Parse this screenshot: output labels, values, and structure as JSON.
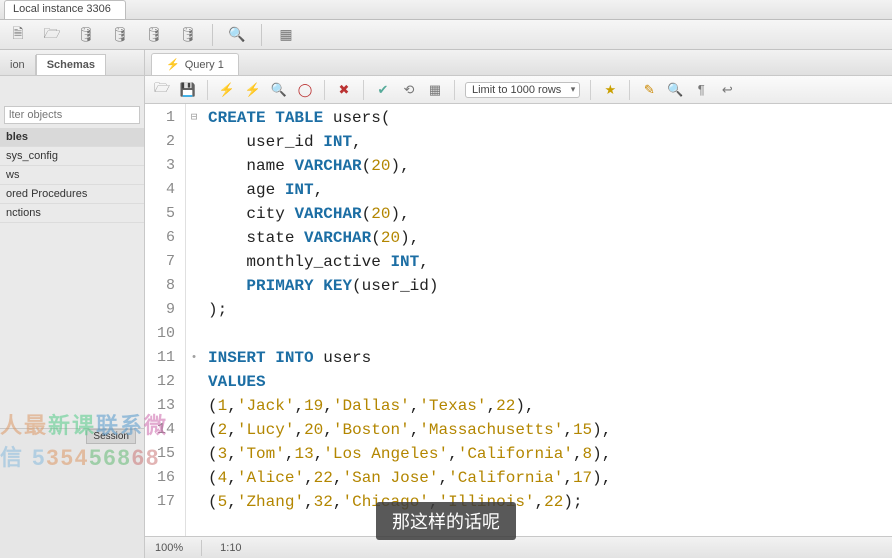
{
  "window": {
    "connection_tab": "Local instance 3306"
  },
  "left": {
    "tabs": {
      "first": "ion",
      "second": "Schemas"
    },
    "filter_placeholder": "lter objects",
    "items": [
      "bles",
      "sys_config",
      "ws",
      "ored Procedures",
      "nctions"
    ],
    "session_label": "Session"
  },
  "query": {
    "tab_label": "Query 1",
    "limit_label": "Limit to 1000 rows"
  },
  "status": {
    "zoom": "100%",
    "pos": "1:10"
  },
  "subtitle": "那这样的话呢",
  "watermark": {
    "line1": "人最新课联系微",
    "line2": "信 535456868"
  },
  "sql_lines": [
    {
      "n": 1,
      "fold": "⊟",
      "tokens": [
        [
          "kw",
          "CREATE TABLE"
        ],
        [
          "id",
          " users"
        ],
        [
          "pn",
          "("
        ]
      ]
    },
    {
      "n": 2,
      "tokens": [
        [
          "id",
          "    user_id "
        ],
        [
          "ty",
          "INT"
        ],
        [
          "pn",
          ","
        ]
      ]
    },
    {
      "n": 3,
      "tokens": [
        [
          "id",
          "    name "
        ],
        [
          "ty",
          "VARCHAR"
        ],
        [
          "pn",
          "("
        ],
        [
          "num",
          "20"
        ],
        [
          "pn",
          "),"
        ]
      ]
    },
    {
      "n": 4,
      "tokens": [
        [
          "id",
          "    age "
        ],
        [
          "ty",
          "INT"
        ],
        [
          "pn",
          ","
        ]
      ]
    },
    {
      "n": 5,
      "tokens": [
        [
          "id",
          "    city "
        ],
        [
          "ty",
          "VARCHAR"
        ],
        [
          "pn",
          "("
        ],
        [
          "num",
          "20"
        ],
        [
          "pn",
          "),"
        ]
      ]
    },
    {
      "n": 6,
      "tokens": [
        [
          "id",
          "    state "
        ],
        [
          "ty",
          "VARCHAR"
        ],
        [
          "pn",
          "("
        ],
        [
          "num",
          "20"
        ],
        [
          "pn",
          "),"
        ]
      ]
    },
    {
      "n": 7,
      "tokens": [
        [
          "id",
          "    monthly_active "
        ],
        [
          "ty",
          "INT"
        ],
        [
          "pn",
          ","
        ]
      ]
    },
    {
      "n": 8,
      "tokens": [
        [
          "id",
          "    "
        ],
        [
          "fn",
          "PRIMARY KEY"
        ],
        [
          "pn",
          "("
        ],
        [
          "id",
          "user_id"
        ],
        [
          "pn",
          ")"
        ]
      ]
    },
    {
      "n": 9,
      "tokens": [
        [
          "pn",
          ");"
        ]
      ]
    },
    {
      "n": 10,
      "tokens": []
    },
    {
      "n": 11,
      "fold": "•",
      "tokens": [
        [
          "kw",
          "INSERT INTO"
        ],
        [
          "id",
          " users"
        ]
      ]
    },
    {
      "n": 12,
      "tokens": [
        [
          "kw",
          "VALUES"
        ]
      ]
    },
    {
      "n": 13,
      "tokens": [
        [
          "pn",
          "("
        ],
        [
          "num",
          "1"
        ],
        [
          "pn",
          ","
        ],
        [
          "str",
          "'Jack'"
        ],
        [
          "pn",
          ","
        ],
        [
          "num",
          "19"
        ],
        [
          "pn",
          ","
        ],
        [
          "str",
          "'Dallas'"
        ],
        [
          "pn",
          ","
        ],
        [
          "str",
          "'Texas'"
        ],
        [
          "pn",
          ","
        ],
        [
          "num",
          "22"
        ],
        [
          "pn",
          "),"
        ]
      ]
    },
    {
      "n": 14,
      "tokens": [
        [
          "pn",
          "("
        ],
        [
          "num",
          "2"
        ],
        [
          "pn",
          ","
        ],
        [
          "str",
          "'Lucy'"
        ],
        [
          "pn",
          ","
        ],
        [
          "num",
          "20"
        ],
        [
          "pn",
          ","
        ],
        [
          "str",
          "'Boston'"
        ],
        [
          "pn",
          ","
        ],
        [
          "str",
          "'Massachusetts'"
        ],
        [
          "pn",
          ","
        ],
        [
          "num",
          "15"
        ],
        [
          "pn",
          "),"
        ]
      ]
    },
    {
      "n": 15,
      "tokens": [
        [
          "pn",
          "("
        ],
        [
          "num",
          "3"
        ],
        [
          "pn",
          ","
        ],
        [
          "str",
          "'Tom'"
        ],
        [
          "pn",
          ","
        ],
        [
          "num",
          "13"
        ],
        [
          "pn",
          ","
        ],
        [
          "str",
          "'Los Angeles'"
        ],
        [
          "pn",
          ","
        ],
        [
          "str",
          "'California'"
        ],
        [
          "pn",
          ","
        ],
        [
          "num",
          "8"
        ],
        [
          "pn",
          "),"
        ]
      ]
    },
    {
      "n": 16,
      "tokens": [
        [
          "pn",
          "("
        ],
        [
          "num",
          "4"
        ],
        [
          "pn",
          ","
        ],
        [
          "str",
          "'Alice'"
        ],
        [
          "pn",
          ","
        ],
        [
          "num",
          "22"
        ],
        [
          "pn",
          ","
        ],
        [
          "str",
          "'San Jose'"
        ],
        [
          "pn",
          ","
        ],
        [
          "str",
          "'California'"
        ],
        [
          "pn",
          ","
        ],
        [
          "num",
          "17"
        ],
        [
          "pn",
          "),"
        ]
      ]
    },
    {
      "n": 17,
      "tokens": [
        [
          "pn",
          "("
        ],
        [
          "num",
          "5"
        ],
        [
          "pn",
          ","
        ],
        [
          "str",
          "'Zhang'"
        ],
        [
          "pn",
          ","
        ],
        [
          "num",
          "32"
        ],
        [
          "pn",
          ","
        ],
        [
          "str",
          "'Chicago'"
        ],
        [
          "pn",
          ","
        ],
        [
          "str",
          "'Illinois'"
        ],
        [
          "pn",
          ","
        ],
        [
          "num",
          "22"
        ],
        [
          "pn",
          ");"
        ]
      ]
    }
  ]
}
